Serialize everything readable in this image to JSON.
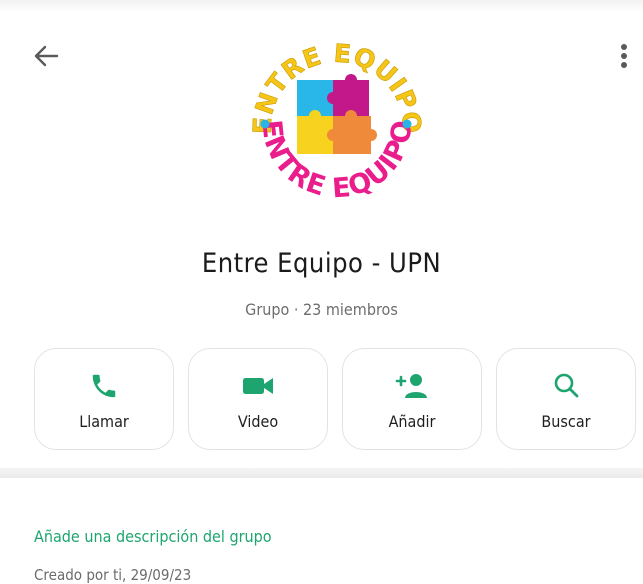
{
  "header": {
    "back_icon": "arrow-left-icon",
    "menu_icon": "more-vertical-icon"
  },
  "logo": {
    "text_top": "ENTRE EQUIPO",
    "text_bottom": "ENTRE EQUIPO",
    "colors": {
      "ring_text": "#e91e8c",
      "top_text": "#f5c518",
      "dots": "#26b5e6"
    }
  },
  "group": {
    "name": "Entre Equipo - UPN",
    "subtitle": "Grupo · 23 miembros"
  },
  "actions": [
    {
      "label": "Llamar",
      "icon": "phone-icon"
    },
    {
      "label": "Video",
      "icon": "video-camera-icon"
    },
    {
      "label": "Añadir",
      "icon": "add-person-icon"
    },
    {
      "label": "Buscar",
      "icon": "search-icon"
    }
  ],
  "description": {
    "add_label": "Añade una descripción del grupo",
    "created": "Creado por ti, 29/09/23"
  },
  "colors": {
    "accent": "#1ea56f",
    "text": "#1c1c1c",
    "muted": "#6d6d6d"
  }
}
